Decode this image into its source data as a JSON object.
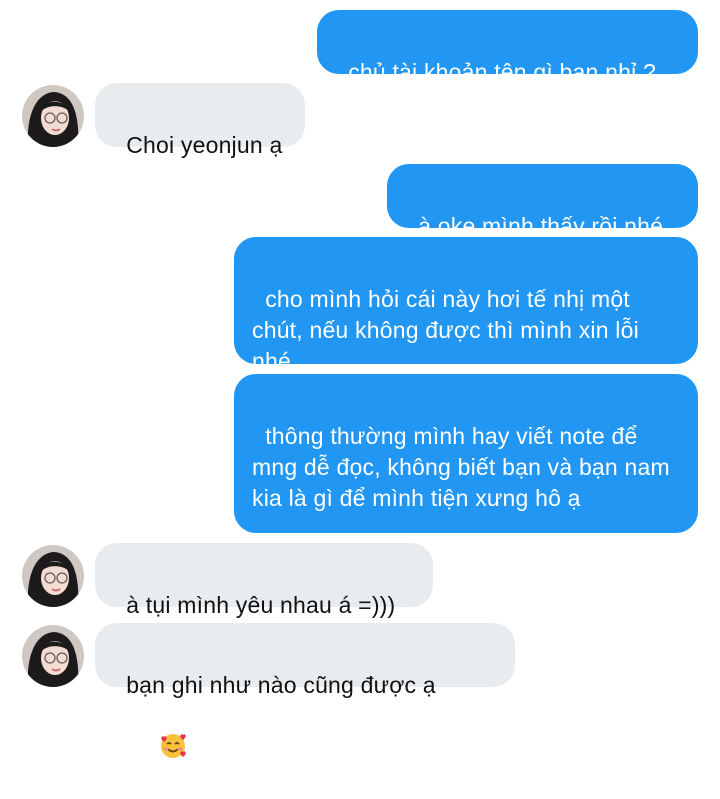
{
  "messages": [
    {
      "side": "out",
      "text": "chủ tài khoản tên gì bạn nhỉ ?"
    },
    {
      "side": "in",
      "text": "Choi yeonjun ạ",
      "avatar": "avatar-icon"
    },
    {
      "side": "out",
      "text": "à oke mình thấy rồi nhé"
    },
    {
      "side": "out",
      "text": "cho mình hỏi cái này hơi tế nhị một chút, nếu không được thì mình xin lỗi nhé"
    },
    {
      "side": "out",
      "text": "thông thường mình hay viết note để mng dễ đọc, không biết bạn và bạn nam kia là gì để mình tiện xưng hô ạ"
    },
    {
      "side": "in",
      "text": "à tụi mình yêu nhau á =)))",
      "avatar": "avatar-icon"
    },
    {
      "side": "in",
      "text": "bạn ghi như nào cũng được ạ",
      "emoji": "smiling-face-with-hearts-icon",
      "avatar": "avatar-icon"
    }
  ],
  "colors": {
    "outgoing_bubble": "#2196f3",
    "incoming_bubble": "#e9ecef",
    "outgoing_text": "#ffffff",
    "incoming_text": "#111111"
  }
}
